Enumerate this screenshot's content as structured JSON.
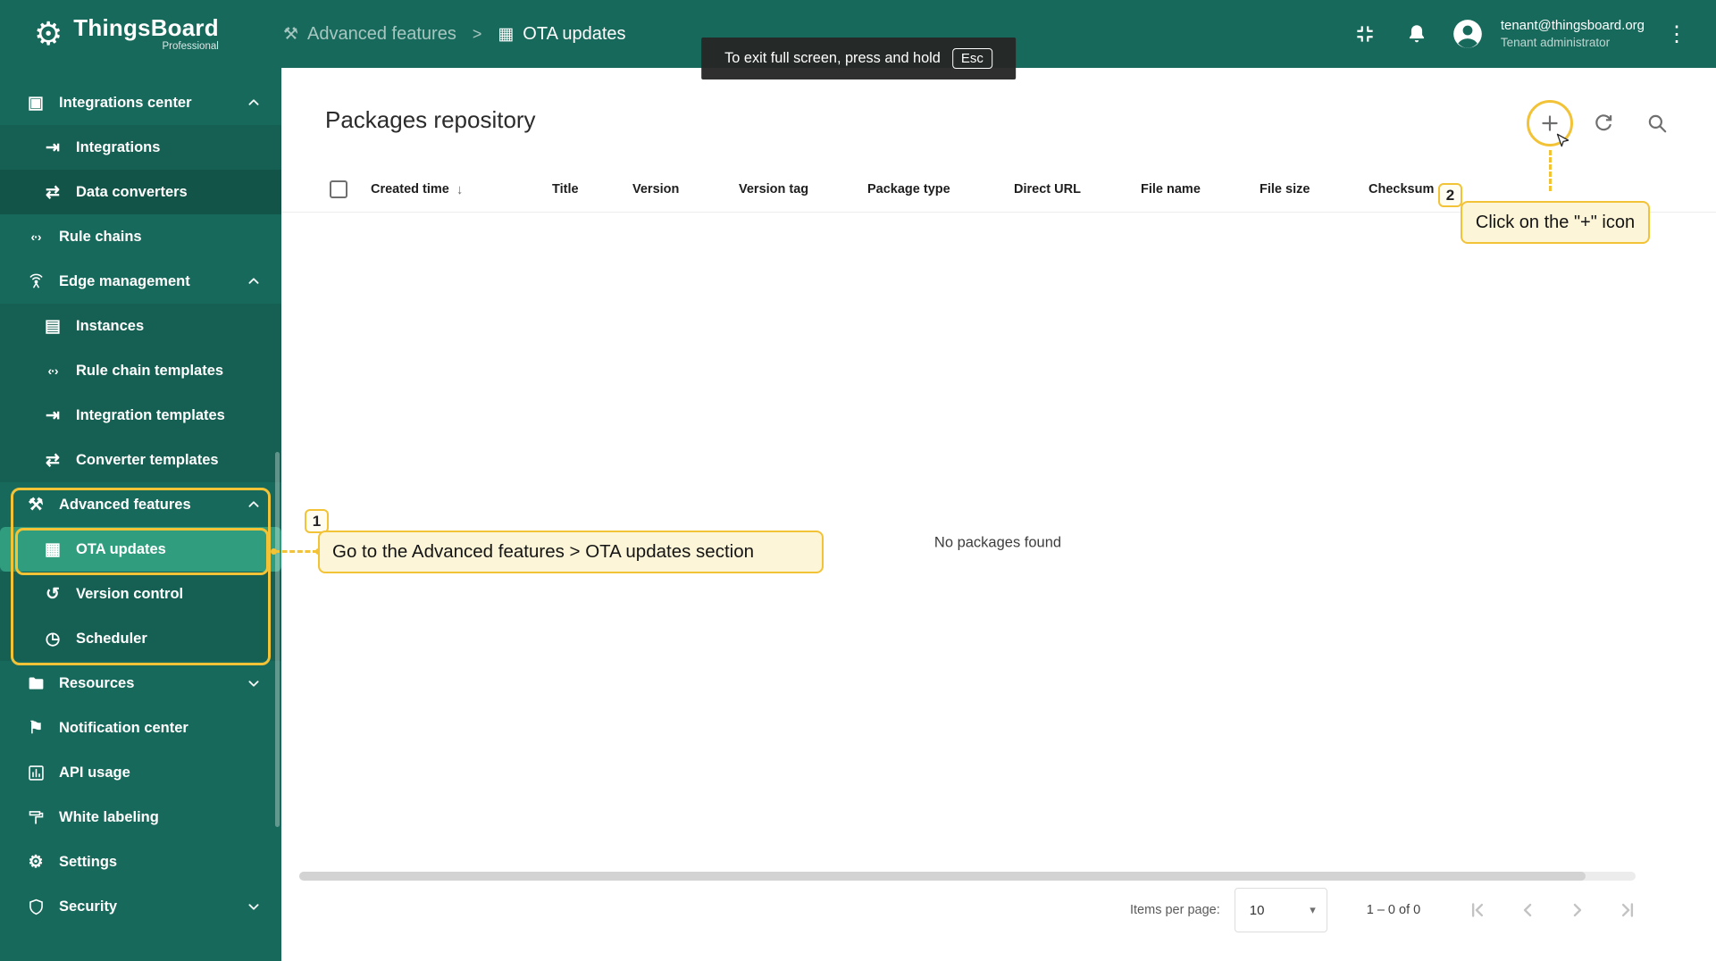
{
  "colors": {
    "brand_green": "#17695B",
    "selected_green": "#2F9D7E",
    "annotation_yellow": "#F2C237"
  },
  "header": {
    "logo_title": "ThingsBoard",
    "logo_subtitle": "Professional",
    "breadcrumb": {
      "section": "Advanced features",
      "separator": ">",
      "page": "OTA updates"
    },
    "fullscreen_tooltip": {
      "text": "To exit full screen, press and hold",
      "key": "Esc"
    },
    "user": {
      "email": "tenant@thingsboard.org",
      "role": "Tenant administrator"
    }
  },
  "sidebar": {
    "items": [
      {
        "label": "Integrations center"
      },
      {
        "label": "Integrations"
      },
      {
        "label": "Data converters"
      },
      {
        "label": "Rule chains"
      },
      {
        "label": "Edge management"
      },
      {
        "label": "Instances"
      },
      {
        "label": "Rule chain templates"
      },
      {
        "label": "Integration templates"
      },
      {
        "label": "Converter templates"
      },
      {
        "label": "Advanced features"
      },
      {
        "label": "OTA updates"
      },
      {
        "label": "Version control"
      },
      {
        "label": "Scheduler"
      },
      {
        "label": "Resources"
      },
      {
        "label": "Notification center"
      },
      {
        "label": "API usage"
      },
      {
        "label": "White labeling"
      },
      {
        "label": "Settings"
      },
      {
        "label": "Security"
      }
    ]
  },
  "main": {
    "title": "Packages repository",
    "table": {
      "columns": [
        "Created time",
        "Title",
        "Version",
        "Version tag",
        "Package type",
        "Direct URL",
        "File name",
        "File size",
        "Checksum"
      ],
      "empty_text": "No packages found"
    },
    "pagination": {
      "items_per_page_label": "Items per page:",
      "items_per_page_value": "10",
      "range_label": "1 – 0 of 0"
    }
  },
  "annotations": {
    "step1": {
      "number": "1",
      "label": "Go to the Advanced features > OTA updates section"
    },
    "step2": {
      "number": "2",
      "label": "Click on the \"+\" icon"
    }
  }
}
